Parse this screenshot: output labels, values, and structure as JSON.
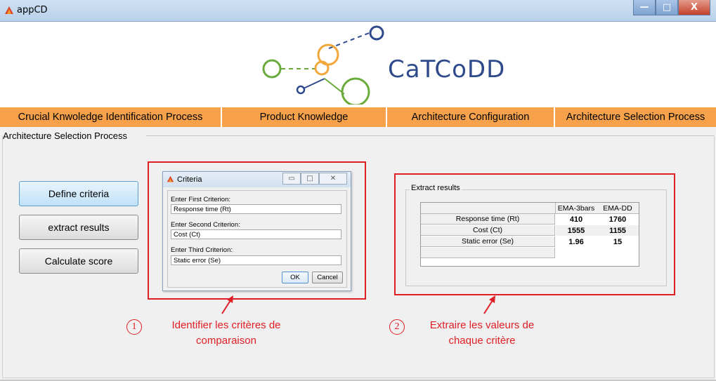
{
  "window": {
    "title": "appCD",
    "minimize": "—",
    "maximize": "□",
    "close": "X"
  },
  "logo": {
    "text": "CaTCoDD"
  },
  "menu": {
    "items": [
      {
        "label": "Crucial Knwoledge Identification Process"
      },
      {
        "label": "Product Knowledge"
      },
      {
        "label": "Architecture Configuration"
      },
      {
        "label": "Architecture Selection Process"
      }
    ]
  },
  "panel": {
    "title": "Architecture Selection Process"
  },
  "buttons": {
    "define": "Define criteria",
    "extract": "extract results",
    "calculate": "Calculate score"
  },
  "dialog": {
    "title": "Criteria",
    "label1": "Enter First Criterion:",
    "value1": "Response time (Rt)",
    "label2": "Enter Second Criterion:",
    "value2": "Cost (Ct)",
    "label3": "Enter Third Criterion:",
    "value3": "Static error (Se)",
    "ok": "OK",
    "cancel": "Cancel"
  },
  "results": {
    "title": "Extract results",
    "columns": [
      "EMA-3bars",
      "EMA-DD"
    ],
    "rows": [
      {
        "label": "Response time (Rt)",
        "values": [
          "410",
          "1760"
        ]
      },
      {
        "label": "Cost (Ct)",
        "values": [
          "1555",
          "1155"
        ]
      },
      {
        "label": "Static error (Se)",
        "values": [
          "1.96",
          "15"
        ]
      }
    ]
  },
  "annotations": {
    "num1": "1",
    "line1a": "Identifier les critères de",
    "line1b": "comparaison",
    "num2": "2",
    "line2a": "Extraire les valeurs de",
    "line2b": "chaque critère"
  },
  "colors": {
    "menu": "#f7a24b",
    "annotation": "#e01e25",
    "logo_text": "#2e4a8a"
  }
}
